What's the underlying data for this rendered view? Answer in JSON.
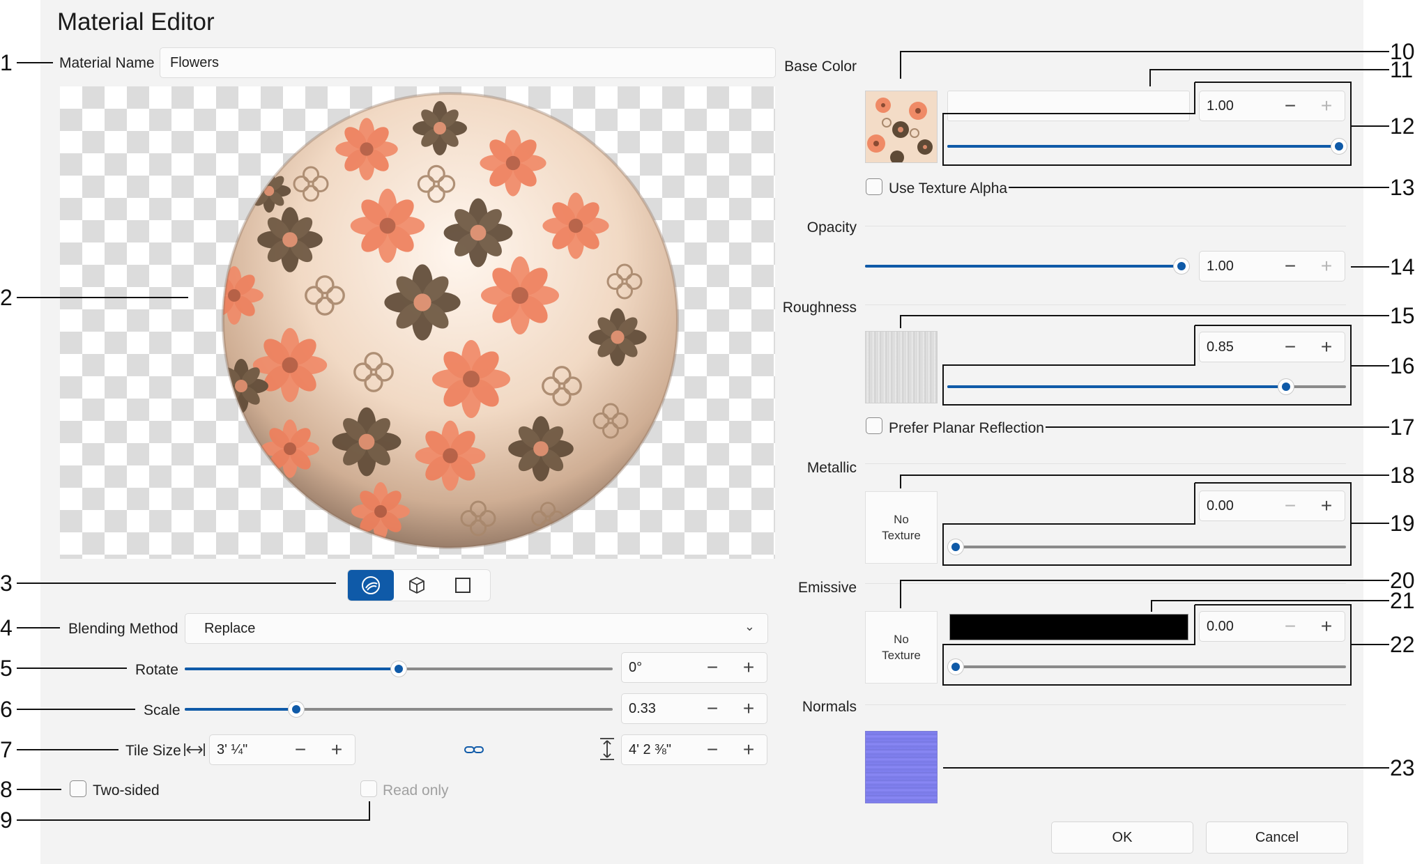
{
  "window": {
    "title": "Material Editor"
  },
  "left": {
    "material_name_label": "Material Name",
    "material_name_value": "Flowers",
    "blending_label": "Blending Method",
    "blending_value": "Replace",
    "rotate": {
      "label": "Rotate",
      "value": "0°",
      "level": 0.5
    },
    "scale": {
      "label": "Scale",
      "value": "0.33",
      "level": 0.26
    },
    "tile_size": {
      "label": "Tile Size",
      "width": "3' ¼\"",
      "height": "4' 2 ⅜\""
    },
    "two_sided_label": "Two-sided",
    "read_only_label": "Read only",
    "view_modes": [
      "sphere-view-icon",
      "cube-view-icon",
      "plane-view-icon"
    ],
    "preview_icon": "textured-sphere-preview"
  },
  "right": {
    "base_color": {
      "label": "Base Color",
      "value": "1.00",
      "level": 1.0
    },
    "use_texture_alpha_label": "Use Texture Alpha",
    "opacity": {
      "label": "Opacity",
      "value": "1.00",
      "level": 1.0
    },
    "roughness": {
      "label": "Roughness",
      "value": "0.85",
      "level": 0.85
    },
    "prefer_planar_label": "Prefer Planar Reflection",
    "metallic": {
      "label": "Metallic",
      "value": "0.00",
      "level": 0.0,
      "texture_line1": "No",
      "texture_line2": "Texture"
    },
    "emissive": {
      "label": "Emissive",
      "value": "0.00",
      "level": 0.0,
      "texture_line1": "No",
      "texture_line2": "Texture",
      "color": "#000000"
    },
    "normals": {
      "label": "Normals"
    }
  },
  "buttons": {
    "ok": "OK",
    "cancel": "Cancel"
  },
  "callouts": [
    "1",
    "2",
    "3",
    "4",
    "5",
    "6",
    "7",
    "8",
    "9",
    "10",
    "11",
    "12",
    "13",
    "14",
    "15",
    "16",
    "17",
    "18",
    "19",
    "20",
    "21",
    "22",
    "23"
  ],
  "colors": {
    "accent": "#0f5aa8",
    "panel": "#f3f3f3"
  }
}
